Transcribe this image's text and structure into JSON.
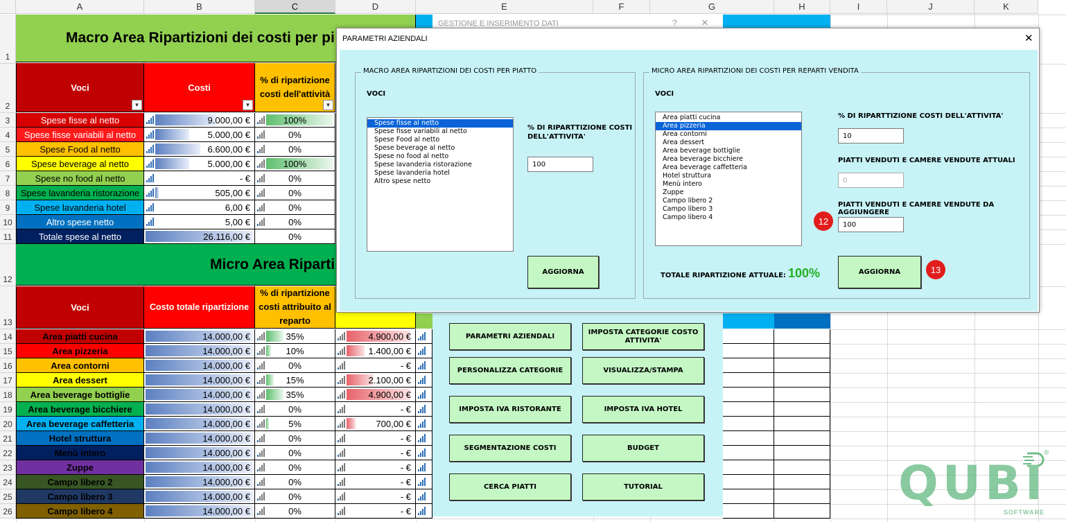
{
  "columns": [
    "A",
    "B",
    "C",
    "D",
    "E",
    "F",
    "G",
    "H",
    "I",
    "J",
    "K"
  ],
  "rows": [
    "1",
    "2",
    "3",
    "4",
    "5",
    "6",
    "7",
    "8",
    "9",
    "10",
    "11",
    "12",
    "13",
    "14",
    "15",
    "16",
    "17",
    "18",
    "19",
    "20",
    "21",
    "22",
    "23",
    "24",
    "25",
    "26"
  ],
  "macro": {
    "title": "Macro Area Ripartizioni dei costi per pi",
    "header_voci": "Voci",
    "header_costi": "Costi",
    "header_pct": "% di ripartizione costi dell'attività",
    "rows": [
      {
        "voce": "Spese fisse al netto",
        "costo": "9.000,00 €",
        "pct": "100%",
        "bar": 0.34,
        "pbar": 1.0,
        "color": "#d60000"
      },
      {
        "voce": "Spese fisse variabili al netto",
        "costo": "5.000,00 €",
        "pct": "0%",
        "bar": 0.19,
        "pbar": 0,
        "color": "#ff1a1a"
      },
      {
        "voce": "Spese Food al netto",
        "costo": "6.600,00 €",
        "pct": "0%",
        "bar": 0.25,
        "pbar": 0,
        "color": "#ffc000"
      },
      {
        "voce": "Spese beverage al netto",
        "costo": "5.000,00 €",
        "pct": "100%",
        "bar": 0.19,
        "pbar": 1.0,
        "color": "#ffff00"
      },
      {
        "voce": "Spese no food al netto",
        "costo": "-      €",
        "pct": "0%",
        "bar": 0,
        "pbar": 0,
        "color": "#92d050"
      },
      {
        "voce": "Spese lavanderia ristorazione",
        "costo": "505,00 €",
        "pct": "0%",
        "bar": 0.02,
        "pbar": 0,
        "color": "#00b050"
      },
      {
        "voce": "Spese lavanderia hotel",
        "costo": "6,00 €",
        "pct": "0%",
        "bar": 0,
        "pbar": 0,
        "color": "#00b0f0"
      },
      {
        "voce": "Altro spese netto",
        "costo": "5,00 €",
        "pct": "0%",
        "bar": 0,
        "pbar": 0,
        "color": "#0070c0"
      }
    ],
    "total_label": "Totale spese al netto",
    "total_value": "26.116,00 €",
    "total_pct": "0%"
  },
  "micro": {
    "title": "Micro Area Riparti",
    "header_voci": "Voci",
    "header_costo": "Costo totale ripartizione",
    "header_pct": "% di ripartizione costi attribuito al reparto",
    "rows": [
      {
        "voce": "Area piatti cucina",
        "costo": "14.000,00 €",
        "pct": "35%",
        "val": "4.900,00 €",
        "p": 0.35,
        "color": "#c00000"
      },
      {
        "voce": "Area pizzeria",
        "costo": "14.000,00 €",
        "pct": "10%",
        "val": "1.400,00 €",
        "p": 0.1,
        "color": "#ff0000"
      },
      {
        "voce": "Area contorni",
        "costo": "14.000,00 €",
        "pct": "0%",
        "val": "-      €",
        "p": 0,
        "color": "#ffc000"
      },
      {
        "voce": "Area dessert",
        "costo": "14.000,00 €",
        "pct": "15%",
        "val": "2.100,00 €",
        "p": 0.15,
        "color": "#ffff00"
      },
      {
        "voce": "Area beverage bottiglie",
        "costo": "14.000,00 €",
        "pct": "35%",
        "val": "4.900,00 €",
        "p": 0.35,
        "color": "#92d050"
      },
      {
        "voce": "Area beverage bicchiere",
        "costo": "14.000,00 €",
        "pct": "0%",
        "val": "-      €",
        "p": 0,
        "color": "#00b050"
      },
      {
        "voce": "Area beverage caffetteria",
        "costo": "14.000,00 €",
        "pct": "5%",
        "val": "700,00 €",
        "p": 0.05,
        "color": "#00b0f0"
      },
      {
        "voce": "Hotel struttura",
        "costo": "14.000,00 €",
        "pct": "0%",
        "val": "-      €",
        "p": 0,
        "color": "#0070c0"
      },
      {
        "voce": "Menù intero",
        "costo": "14.000,00 €",
        "pct": "0%",
        "val": "-      €",
        "p": 0,
        "color": "#002060"
      },
      {
        "voce": "Zuppe",
        "costo": "14.000,00 €",
        "pct": "0%",
        "val": "-      €",
        "p": 0,
        "color": "#7030a0"
      },
      {
        "voce": "Campo libero 2",
        "costo": "14.000,00 €",
        "pct": "0%",
        "val": "-      €",
        "p": 0,
        "color": "#375623"
      },
      {
        "voce": "Campo libero 3",
        "costo": "14.000,00 €",
        "pct": "0%",
        "val": "-      €",
        "p": 0,
        "color": "#1f3864"
      },
      {
        "voce": "Campo libero 4",
        "costo": "14.000,00 €",
        "pct": "0%",
        "val": "-      €",
        "p": 0,
        "color": "#806000"
      }
    ]
  },
  "back_form": {
    "title": "GESTIONE E INSERIMENTO DATI",
    "help": "?",
    "close": "×",
    "buttons": [
      "PARAMETRI AZIENDALI",
      "IMPOSTA CATEGORIE COSTO ATTIVITA'",
      "PERSONALIZZA CATEGORIE",
      "VISUALIZZA/STAMPA",
      "IMPOSTA IVA RISTORANTE",
      "IMPOSTA IVA HOTEL",
      "SEGMENTAZIONE COSTI",
      "BUDGET",
      "CERCA PIATTI",
      "TUTORIAL"
    ]
  },
  "dialog": {
    "title": "PARAMETRI AZIENDALI",
    "close": "✕",
    "macro_frame": "MACRO AREA RIPARTIZIONI DEI COSTI PER PIATTO",
    "macro_voci": "VOCI",
    "macro_list": [
      "Spese fisse al netto",
      "Spese fisse variabili al netto",
      "Spese Food al netto",
      "Spese beverage al netto",
      "Spese no food al netto",
      "Spese lavanderia ristorazione",
      "Spese lavanderia hotel",
      "Altro spese netto"
    ],
    "macro_pct_label": "% DI RIPARTTIZIONE COSTI DELL'ATTIVITA'",
    "macro_pct_value": "100",
    "macro_update": "AGGIORNA",
    "micro_frame": "MICRO AREA RIPARTIZIONI DEI COSTI PER REPARTI VENDITA",
    "micro_voci": "VOCI",
    "micro_list": [
      "Area piatti cucina",
      "Area pizzeria",
      "Area contorni",
      "Area dessert",
      "Area beverage bottiglie",
      "Area beverage bicchiere",
      "Area beverage caffetteria",
      "Hotel struttura",
      "Menù intero",
      "Zuppe",
      "Campo libero 2",
      "Campo libero 3",
      "Campo libero 4"
    ],
    "micro_pct_label": "% DI RIPARTTIZIONE COSTI DELL'ATTIVITA'",
    "micro_pct_value": "10",
    "sold_label": "PIATTI VENDUTI E CAMERE VENDUTE ATTUALI",
    "sold_value": "0",
    "add_label": "PIATTI VENDUTI E CAMERE VENDUTE DA AGGIUNGERE",
    "add_value": "100",
    "total_label": "TOTALE RIPARTIZIONE ATTUALE:",
    "total_value": "100%",
    "micro_update": "AGGIORNA"
  },
  "badges": {
    "b12": "12",
    "b13": "13"
  },
  "logo": {
    "text": "QUBI",
    "sub": "SOFTWARE",
    "reg": "®"
  }
}
